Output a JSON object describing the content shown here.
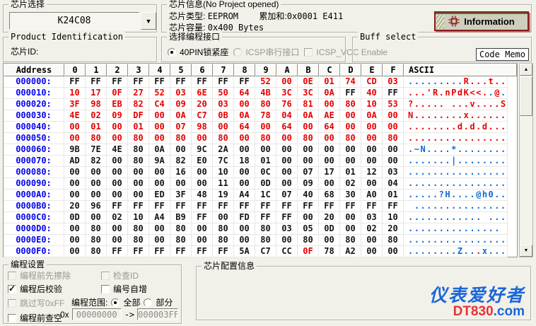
{
  "chip_select": {
    "group_label": "芯片选择",
    "value": "K24C08"
  },
  "chip_info": {
    "group_label": "芯片信息(No Project opened)",
    "type_label": "芯片类型:",
    "type_value": "EEPROM",
    "sum_label": "累加和:",
    "sum_value": "0x0001 E411",
    "cap_label": "芯片容量:",
    "cap_value": "0x400 Bytes",
    "info_button_label": "Information"
  },
  "product_id": {
    "group_label": "Product Identification",
    "chip_id_label": "芯片ID:"
  },
  "interface": {
    "group_label": "选择编程接口",
    "options": [
      {
        "kind": "radio",
        "label": "40PIN锁紧座",
        "selected": true,
        "enabled": true
      },
      {
        "kind": "radio",
        "label": "ICSP串行接口",
        "selected": false,
        "enabled": false
      },
      {
        "kind": "check",
        "label": "ICSP_VCC Enable",
        "checked": false,
        "enabled": false
      }
    ]
  },
  "buff_select": {
    "group_label": "Buff select",
    "value": "Code Memo"
  },
  "hex_grid": {
    "headers": [
      "Address",
      "0",
      "1",
      "2",
      "3",
      "4",
      "5",
      "6",
      "7",
      "8",
      "9",
      "A",
      "B",
      "C",
      "D",
      "E",
      "F",
      "ASCII"
    ],
    "colors": {
      "hex_red": "#e60000",
      "hex_black": "#141414",
      "ascii_blue": "#0a6ad6",
      "address_blue": "#0404f0"
    },
    "rows": [
      {
        "addr": "000000:",
        "mode": "red",
        "bytes": [
          "FF",
          "FF",
          "FF",
          "FF",
          "FF",
          "FF",
          "FF",
          "FF",
          "FF",
          "52",
          "00",
          "0E",
          "01",
          "74",
          "CD",
          "03"
        ],
        "ascii": ".........R...t.."
      },
      {
        "addr": "000010:",
        "mode": "red",
        "bytes": [
          "10",
          "17",
          "0F",
          "27",
          "52",
          "03",
          "6E",
          "50",
          "64",
          "4B",
          "3C",
          "3C",
          "0A",
          "FF",
          "40",
          "FF"
        ],
        "ascii": "...'R.nPdK<<..@."
      },
      {
        "addr": "000020:",
        "mode": "red",
        "bytes": [
          "3F",
          "98",
          "EB",
          "82",
          "C4",
          "09",
          "20",
          "03",
          "00",
          "80",
          "76",
          "81",
          "00",
          "80",
          "10",
          "53"
        ],
        "ascii": "?..... ...v....S"
      },
      {
        "addr": "000030:",
        "mode": "red",
        "bytes": [
          "4E",
          "02",
          "09",
          "DF",
          "00",
          "0A",
          "C7",
          "0B",
          "0A",
          "78",
          "04",
          "0A",
          "AE",
          "00",
          "0A",
          "00"
        ],
        "ascii": "N........x......"
      },
      {
        "addr": "000040:",
        "mode": "red",
        "bytes": [
          "00",
          "01",
          "00",
          "01",
          "00",
          "07",
          "98",
          "00",
          "64",
          "00",
          "64",
          "00",
          "64",
          "00",
          "00",
          "00"
        ],
        "ascii": "........d.d.d..."
      },
      {
        "addr": "000050:",
        "mode": "red",
        "bytes": [
          "00",
          "80",
          "00",
          "80",
          "00",
          "80",
          "00",
          "80",
          "00",
          "80",
          "00",
          "80",
          "00",
          "80",
          "00",
          "80"
        ],
        "ascii": "................"
      },
      {
        "addr": "000060:",
        "mode": "black",
        "bytes": [
          "9B",
          "7E",
          "4E",
          "80",
          "0A",
          "00",
          "9C",
          "2A",
          "00",
          "00",
          "00",
          "00",
          "00",
          "00",
          "00",
          "00"
        ],
        "ascii": ".~N....*........"
      },
      {
        "addr": "000070:",
        "mode": "black",
        "bytes": [
          "AD",
          "82",
          "00",
          "80",
          "9A",
          "82",
          "E0",
          "7C",
          "18",
          "01",
          "00",
          "00",
          "00",
          "00",
          "00",
          "00"
        ],
        "ascii": ".......|........"
      },
      {
        "addr": "000080:",
        "mode": "black",
        "bytes": [
          "00",
          "00",
          "00",
          "00",
          "00",
          "16",
          "00",
          "10",
          "00",
          "0C",
          "00",
          "07",
          "17",
          "01",
          "12",
          "03"
        ],
        "ascii": "................"
      },
      {
        "addr": "000090:",
        "mode": "black",
        "bytes": [
          "00",
          "00",
          "00",
          "00",
          "00",
          "00",
          "00",
          "11",
          "00",
          "0D",
          "00",
          "09",
          "00",
          "02",
          "00",
          "04"
        ],
        "ascii": "................"
      },
      {
        "addr": "0000A0:",
        "mode": "black",
        "bytes": [
          "00",
          "00",
          "00",
          "00",
          "ED",
          "3F",
          "48",
          "19",
          "A4",
          "1C",
          "07",
          "40",
          "68",
          "30",
          "A0",
          "01"
        ],
        "ascii": ".....?H....@h0.."
      },
      {
        "addr": "0000B0:",
        "mode": "black",
        "bytes": [
          "20",
          "96",
          "FF",
          "FF",
          "FF",
          "FF",
          "FF",
          "FF",
          "FF",
          "FF",
          "FF",
          "FF",
          "FF",
          "FF",
          "FF",
          "FF"
        ],
        "ascii": " ..............."
      },
      {
        "addr": "0000C0:",
        "mode": "black",
        "bytes": [
          "0D",
          "00",
          "02",
          "10",
          "A4",
          "B9",
          "FF",
          "00",
          "FD",
          "FF",
          "FF",
          "00",
          "20",
          "00",
          "03",
          "10"
        ],
        "ascii": "............ ..."
      },
      {
        "addr": "0000D0:",
        "mode": "black",
        "bytes": [
          "00",
          "80",
          "00",
          "80",
          "00",
          "80",
          "00",
          "80",
          "00",
          "80",
          "03",
          "05",
          "0D",
          "00",
          "02",
          "20"
        ],
        "ascii": "............... "
      },
      {
        "addr": "0000E0:",
        "mode": "black",
        "bytes": [
          "00",
          "80",
          "00",
          "80",
          "00",
          "80",
          "00",
          "80",
          "00",
          "80",
          "00",
          "80",
          "00",
          "80",
          "00",
          "80"
        ],
        "ascii": "................"
      },
      {
        "addr": "0000F0:",
        "mode": "black",
        "bytes": [
          "00",
          "80",
          "FF",
          "FF",
          "FF",
          "FF",
          "FF",
          "FF",
          "5A",
          "C7",
          "CC",
          "0F",
          "78",
          "A2",
          "00",
          "00"
        ],
        "ascii": "........Z...x...",
        "red_bytes": [
          11
        ]
      }
    ]
  },
  "prog_settings": {
    "group_label": "编程设置",
    "checkboxes": [
      {
        "label": "编程前先擦除",
        "checked": false,
        "enabled": false
      },
      {
        "label": "编程后校验",
        "checked": true,
        "enabled": true
      },
      {
        "label": "跳过写0xFF",
        "checked": false,
        "enabled": false
      },
      {
        "label": "编程前查空",
        "checked": false,
        "enabled": true
      },
      {
        "label": "检查ID",
        "checked": false,
        "enabled": false
      },
      {
        "label": "编号自增",
        "checked": false,
        "enabled": true
      }
    ],
    "range": {
      "label": "编程范围:",
      "options": [
        {
          "kind": "radio",
          "label": "全部",
          "selected": true,
          "enabled": true
        },
        {
          "kind": "radio",
          "label": "部分",
          "selected": false,
          "enabled": true
        }
      ],
      "prefix": "0x",
      "from": "00000000",
      "arrow": "->",
      "to": "000003FF"
    }
  },
  "chip_config": {
    "group_label": "芯片配置信息"
  },
  "watermark": {
    "brand": "仪表爱好者",
    "site_red": "DT830",
    "site_blue": ".com"
  }
}
